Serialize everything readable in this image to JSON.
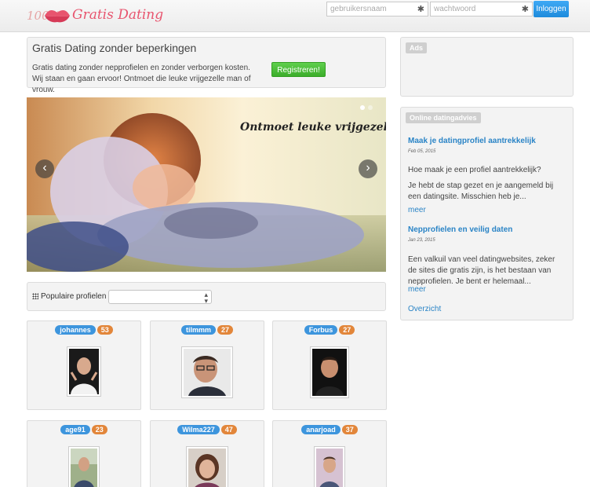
{
  "header": {
    "logo_percent": "100%",
    "logo_text": "Gratis Dating",
    "username_placeholder": "gebruikersnaam",
    "password_placeholder": "wachtwoord",
    "required_mark": "✱",
    "login_label": "Inloggen"
  },
  "intro": {
    "title": "Gratis Dating zonder beperkingen",
    "text": "Gratis dating zonder nepprofielen en zonder verborgen kosten. Wij staan en gaan ervoor! Ontmoet die leuke vrijgezelle man of vrouw.",
    "register_label": "Registreren!"
  },
  "slider": {
    "caption": "Ontmoet leuke vrijgezellen!",
    "prev_icon": "chevron-left-icon",
    "next_icon": "chevron-right-icon"
  },
  "filter": {
    "label": "Populaire profielen",
    "selected": ""
  },
  "profiles": [
    {
      "name": "johannes",
      "age": "53"
    },
    {
      "name": "tilmmm",
      "age": "27"
    },
    {
      "name": "Forbus",
      "age": "27"
    },
    {
      "name": "age91",
      "age": "23"
    },
    {
      "name": "Wilma227",
      "age": "47"
    },
    {
      "name": "anarjoad",
      "age": "37"
    }
  ],
  "sidebar": {
    "ads_label": "Ads",
    "advice_label": "Online datingadvies",
    "articles": [
      {
        "title": "Maak je datingprofiel aantrekkelijk",
        "date": "Feb 05, 2015",
        "lead": "Hoe maak je een profiel aantrekkelijk?",
        "text": "Je hebt de stap gezet en je aangemeld bij een datingsite. Misschien heb je...",
        "more": "meer"
      },
      {
        "title": "Nepprofielen en veilig daten",
        "date": "Jan 23, 2015",
        "text": "Een valkuil van veel datingwebsites, zeker de sites die gratis zijn, is het bestaan van nepprofielen. Je bent er helemaal...",
        "more": "meer"
      }
    ],
    "overview": "Overzicht"
  },
  "colors": {
    "brand": "#e8546e",
    "link": "#2a84c6",
    "login_button": "#2b96e6",
    "register_button": "#45b934",
    "name_badge": "#3d95dd",
    "age_badge": "#e2863a"
  }
}
